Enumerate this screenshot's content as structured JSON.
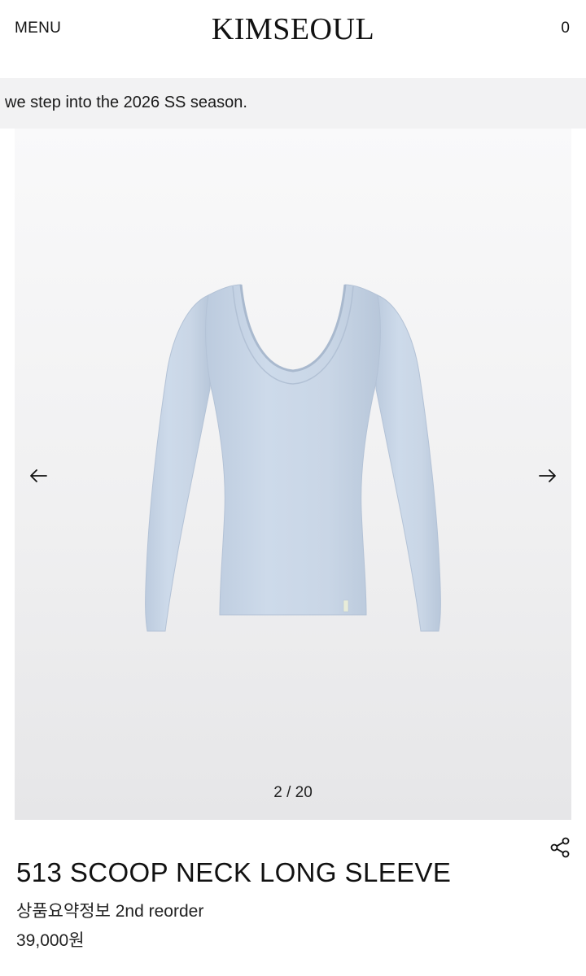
{
  "header": {
    "menu_label": "MENU",
    "brand": "KIMSEOUL",
    "cart_count": "0"
  },
  "announcement": {
    "text": "we step into the 2026 SS season."
  },
  "gallery": {
    "image_subject": "light blue scoop neck long sleeve top",
    "product_color": "#c9d6e6",
    "counter": "2 / 20",
    "prev_icon": "arrow-left-icon",
    "next_icon": "arrow-right-icon"
  },
  "product": {
    "title": "513 SCOOP NECK LONG SLEEVE",
    "summary": "상품요약정보 2nd reorder",
    "price": "39,000원",
    "share_icon": "share-icon"
  }
}
